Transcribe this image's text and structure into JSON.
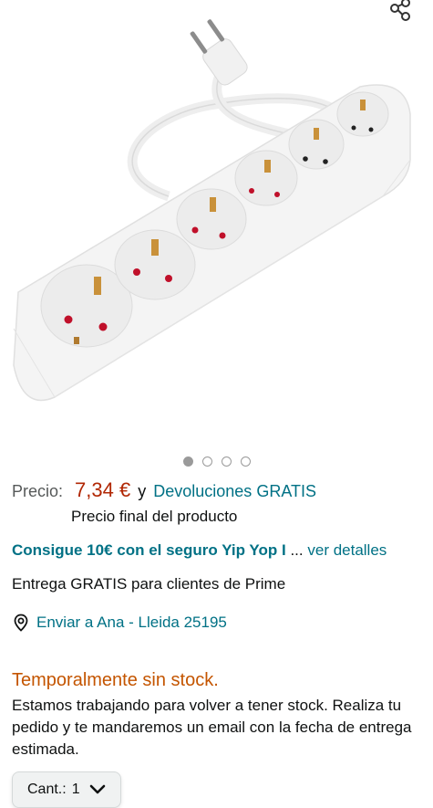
{
  "gallery": {
    "image_alt": "Regleta de 5 enchufes blanca con cable",
    "dots_count": 4,
    "active_dot": 0
  },
  "price": {
    "label": "Precio:",
    "value": "7,34 €",
    "and": "y",
    "returns": "Devoluciones GRATIS",
    "final_note": "Precio final del producto"
  },
  "insurance": {
    "link": "Consigue 10€ con el seguro Yip Yop I",
    "ellipsis": " ... ",
    "details": "ver detalles"
  },
  "delivery": {
    "text": "Entrega GRATIS para clientes de Prime"
  },
  "location": {
    "text": "Enviar a Ana - Lleida 25195",
    "icon": "location-pin-icon"
  },
  "stock": {
    "title": "Temporalmente sin stock.",
    "message": "Estamos trabajando para volver a tener stock. Realiza tu pedido y te mandaremos un email con la fecha de entrega estimada."
  },
  "quantity": {
    "label": "Cant.:",
    "value": "1"
  },
  "colors": {
    "price": "#b12704",
    "link": "#007185",
    "stock": "#c45500",
    "dot": "#9a9a9a"
  }
}
